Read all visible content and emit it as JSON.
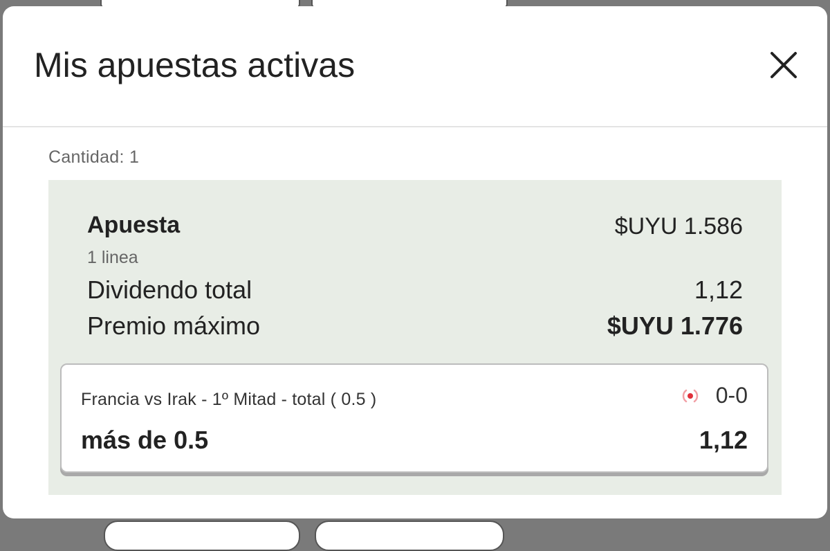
{
  "modal": {
    "title": "Mis apuestas activas",
    "close_icon": "close-icon"
  },
  "summary": {
    "quantity": "Cantidad: 1"
  },
  "bet": {
    "label": "Apuesta",
    "amount": "$UYU 1.586",
    "lines": "1 linea",
    "dividend_label": "Dividendo total",
    "dividend_value": "1,12",
    "max_prize_label": "Premio máximo",
    "max_prize_value": "$UYU 1.776"
  },
  "selection": {
    "market": "Francia vs Irak - 1º Mitad - total ( 0.5 )",
    "live_icon": "live-indicator-icon",
    "score": "0-0",
    "pick": "más de 0.5",
    "odds": "1,12"
  },
  "colors": {
    "panel_background": "#e8ede6",
    "live_indicator": "#e0303a"
  }
}
